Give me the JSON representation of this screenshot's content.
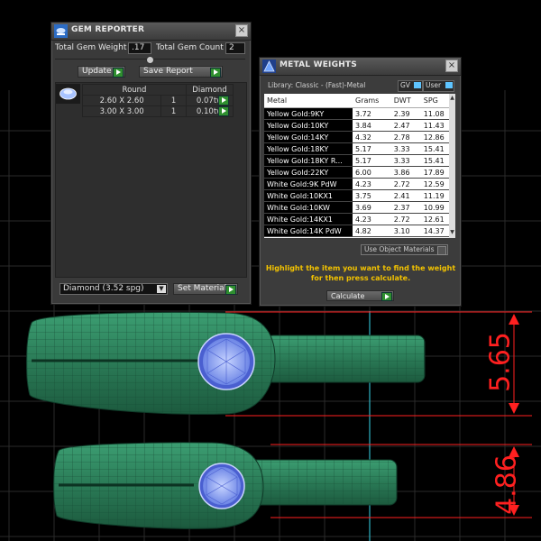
{
  "gem_reporter": {
    "title": "GEM REPORTER",
    "total_gem_weight_label": "Total Gem Weight",
    "total_gem_weight_value": ".17",
    "total_gem_count_label": "Total Gem Count",
    "total_gem_count_value": "2",
    "update_label": "Update",
    "save_report_label": "Save Report",
    "table_headers": [
      "Round",
      "Diamond"
    ],
    "rows": [
      {
        "size": "2.60 X 2.60",
        "count": "1",
        "weight": "0.07tw"
      },
      {
        "size": "3.00 X 3.00",
        "count": "1",
        "weight": "0.10tw"
      }
    ],
    "material_select": "Diamond    (3.52 spg)",
    "set_material_label": "Set Material"
  },
  "metal_weights": {
    "title": "METAL WEIGHTS",
    "library_label": "Library: Classic - (Fast)-Metal",
    "gv_label": "GV",
    "user_label": "User",
    "columns": [
      "Metal",
      "Grams",
      "DWT",
      "SPG"
    ],
    "rows": [
      {
        "metal": "Yellow Gold:9KY",
        "grams": "3.72",
        "dwt": "2.39",
        "spg": "11.08"
      },
      {
        "metal": "Yellow Gold:10KY",
        "grams": "3.84",
        "dwt": "2.47",
        "spg": "11.43"
      },
      {
        "metal": "Yellow Gold:14KY",
        "grams": "4.32",
        "dwt": "2.78",
        "spg": "12.86"
      },
      {
        "metal": "Yellow Gold:18KY",
        "grams": "5.17",
        "dwt": "3.33",
        "spg": "15.41"
      },
      {
        "metal": "Yellow Gold:18KY R...",
        "grams": "5.17",
        "dwt": "3.33",
        "spg": "15.41"
      },
      {
        "metal": "Yellow Gold:22KY",
        "grams": "6.00",
        "dwt": "3.86",
        "spg": "17.89"
      },
      {
        "metal": "White Gold:9K PdW",
        "grams": "4.23",
        "dwt": "2.72",
        "spg": "12.59"
      },
      {
        "metal": "White Gold:10KX1",
        "grams": "3.75",
        "dwt": "2.41",
        "spg": "11.19"
      },
      {
        "metal": "White Gold:10KW",
        "grams": "3.69",
        "dwt": "2.37",
        "spg": "10.99"
      },
      {
        "metal": "White Gold:14KX1",
        "grams": "4.23",
        "dwt": "2.72",
        "spg": "12.61"
      },
      {
        "metal": "White Gold:14K PdW",
        "grams": "4.82",
        "dwt": "3.10",
        "spg": "14.37"
      }
    ],
    "use_object_materials_label": "Use Object Materials",
    "hint_line1": "Highlight the item you want to find the weight",
    "hint_line2": "for then press calculate.",
    "calculate_label": "Calculate"
  },
  "dimensions": {
    "top": "5.65",
    "bottom": "4.86"
  },
  "colors": {
    "model_green": "#2f8a62",
    "gem_blue": "#8aa6f0",
    "dimension_red": "#ff2020",
    "hint_yellow": "#f2c200",
    "grid": "#2c2c2c"
  }
}
